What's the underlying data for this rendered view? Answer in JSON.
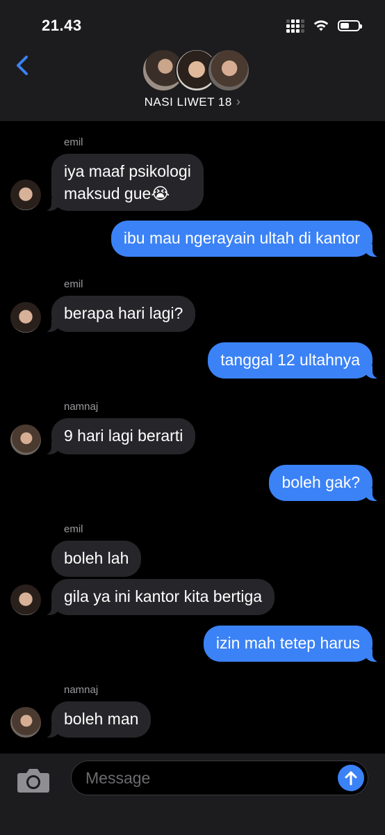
{
  "status_bar": {
    "time": "21.43"
  },
  "header": {
    "group_name": "NASI LIWET 18",
    "chevron": "›"
  },
  "messages": [
    {
      "sender": "emil",
      "text_lines": [
        "iya maaf psikologi",
        "maksud gue😭"
      ]
    },
    {
      "text": "ibu mau ngerayain ultah di kantor"
    },
    {
      "sender": "emil",
      "text": "berapa hari lagi?"
    },
    {
      "text": "tanggal 12 ultahnya"
    },
    {
      "sender": "namnaj",
      "text": "9 hari lagi berarti"
    },
    {
      "text": "boleh gak?"
    },
    {
      "sender": "emil",
      "text": "boleh lah"
    },
    {
      "text": "gila ya ini kantor kita bertiga"
    },
    {
      "text": "izin mah tetep harus"
    },
    {
      "sender": "namnaj",
      "text": "boleh man"
    }
  ],
  "input": {
    "placeholder": "Message"
  },
  "colors": {
    "accent": "#3b82f6",
    "incoming_bubble": "#26262a",
    "header_bg": "#1c1c1e"
  },
  "icons": [
    "back-chevron-icon",
    "signal-icon",
    "wifi-icon",
    "battery-icon",
    "camera-icon",
    "send-arrow-icon"
  ]
}
